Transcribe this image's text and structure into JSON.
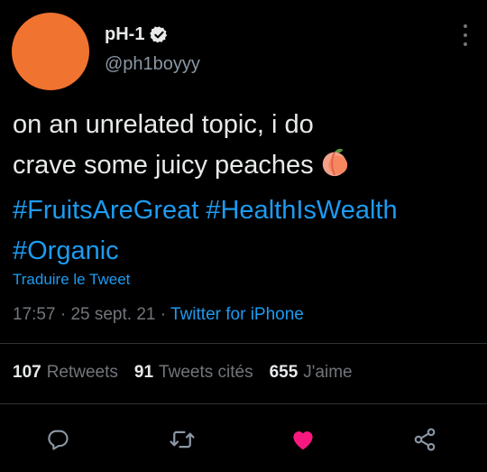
{
  "author": {
    "display_name": "pH-1",
    "handle": "@ph1boyyy",
    "avatar_color": "#f07330",
    "verified": true
  },
  "tweet": {
    "line1": "on an unrelated topic, i do",
    "line2": "crave some juicy peaches",
    "emoji": "peach-emoji",
    "hashtags": [
      "#FruitsAreGreat",
      "#HealthIsWealth",
      "#Organic"
    ]
  },
  "translate_label": "Traduire le Tweet",
  "meta": {
    "time": "17:57",
    "separator": "·",
    "date": "25 sept. 21",
    "source": "Twitter for iPhone"
  },
  "stats": {
    "retweets_count": "107",
    "retweets_label": "Retweets",
    "quotes_count": "91",
    "quotes_label": "Tweets cités",
    "likes_count": "655",
    "likes_label": "J'aime"
  },
  "actions": {
    "reply_icon": "reply-icon",
    "retweet_icon": "retweet-icon",
    "like_icon": "heart-icon",
    "like_color": "#f91880",
    "share_icon": "share-icon"
  },
  "colors": {
    "link": "#1d9bf0",
    "muted": "#71767b",
    "text": "#e7e9ea",
    "divider": "#2f3336"
  }
}
